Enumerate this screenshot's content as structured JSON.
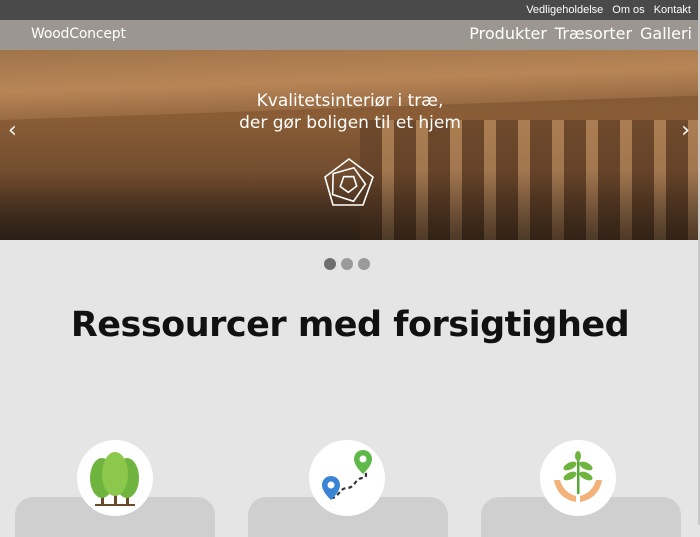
{
  "topbar": {
    "links": [
      "Vedligeholdelse",
      "Om os",
      "Kontakt"
    ]
  },
  "navbar": {
    "logo": "WoodConcept",
    "links": [
      "Produkter",
      "Træsorter",
      "Galleri"
    ]
  },
  "hero": {
    "line1": "Kvalitetsinteriør i træ,",
    "line2": "der gør boligen til et hjem",
    "prev_icon": "chevron-left-icon",
    "next_icon": "chevron-right-icon",
    "prev_glyph": "‹",
    "next_glyph": "›"
  },
  "carousel": {
    "slides": 3,
    "active_index": 0
  },
  "main": {
    "heading": "Ressourcer med forsigtighed"
  },
  "features": [
    {
      "icon": "trees-icon"
    },
    {
      "icon": "route-map-icon"
    },
    {
      "icon": "plant-in-hands-icon"
    }
  ],
  "colors": {
    "topbar": "#4a4a4a",
    "background": "#e5e5e5",
    "card": "#cfcfcf",
    "green": "#6fb43f"
  }
}
